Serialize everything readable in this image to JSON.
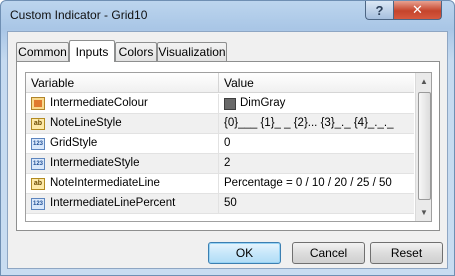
{
  "window": {
    "title": "Custom Indicator - Grid10"
  },
  "titlebar_buttons": {
    "help": "?",
    "close": "✕"
  },
  "tabs": [
    {
      "label": "Common",
      "active": false
    },
    {
      "label": "Inputs",
      "active": true
    },
    {
      "label": "Colors",
      "active": false
    },
    {
      "label": "Visualization",
      "active": false
    }
  ],
  "grid": {
    "columns": {
      "variable": "Variable",
      "value": "Value"
    },
    "rows": [
      {
        "variable": "IntermediateColour",
        "type": "color",
        "value": "DimGray",
        "swatch_color": "#696969"
      },
      {
        "variable": "NoteLineStyle",
        "type": "string",
        "type_icon": "ab",
        "value": "{0}___ {1}_ _ {2}... {3}_._ {4}_._._"
      },
      {
        "variable": "GridStyle",
        "type": "int",
        "type_icon": "123",
        "value": "0"
      },
      {
        "variable": "IntermediateStyle",
        "type": "int",
        "type_icon": "123",
        "value": "2"
      },
      {
        "variable": "NoteIntermediateLine",
        "type": "string",
        "type_icon": "ab",
        "value": "Percentage = 0 / 10 / 20 / 25 / 50"
      },
      {
        "variable": "IntermediateLinePercent",
        "type": "int",
        "type_icon": "123",
        "value": "50"
      }
    ]
  },
  "buttons": {
    "ok": "OK",
    "cancel": "Cancel",
    "reset": "Reset"
  }
}
